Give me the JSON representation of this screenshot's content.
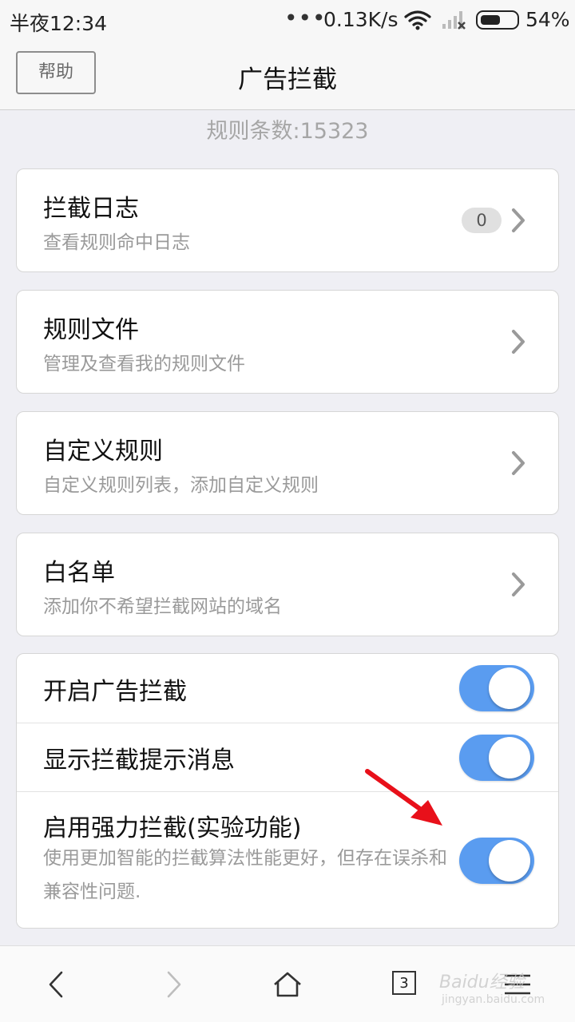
{
  "status_bar": {
    "time": "半夜12:34",
    "dots": "•••",
    "speed": "0.13K/s",
    "battery": "54%",
    "battery_level": 0.54
  },
  "header": {
    "help_label": "帮助",
    "title": "广告拦截"
  },
  "rule_count": "规则条数:15323",
  "cards": [
    {
      "title": "拦截日志",
      "subtitle": "查看规则命中日志",
      "badge": "0"
    },
    {
      "title": "规则文件",
      "subtitle": "管理及查看我的规则文件"
    },
    {
      "title": "自定义规则",
      "subtitle": "自定义规则列表，添加自定义规则"
    },
    {
      "title": "白名单",
      "subtitle": "添加你不希望拦截网站的域名"
    }
  ],
  "settings": [
    {
      "label": "开启广告拦截",
      "enabled": true
    },
    {
      "label": "显示拦截提示消息",
      "enabled": true
    },
    {
      "label": "启用强力拦截(实验功能)",
      "description": "使用更加智能的拦截算法性能更好，但存在误杀和兼容性问题.",
      "enabled": true
    }
  ],
  "bottom_nav": {
    "tabs_count": "3",
    "icons": [
      "back-icon",
      "forward-icon",
      "home-icon",
      "tabs-icon",
      "menu-icon"
    ]
  },
  "watermark": {
    "line1": "Baidu经验",
    "line2": "jingyan.baidu.com"
  },
  "colors": {
    "toggle_on": "#5a9cf0",
    "background": "#efeff4",
    "annotation_arrow": "#e8101a"
  }
}
